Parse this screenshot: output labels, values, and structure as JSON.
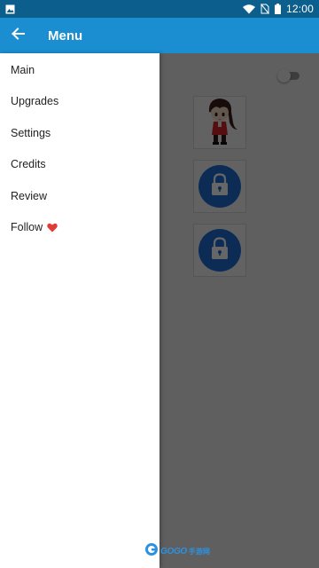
{
  "status_bar": {
    "time": "12:00",
    "color": "#0c5f8c",
    "icons": [
      "gallery-icon",
      "wifi-icon",
      "no-sim-icon",
      "battery-icon"
    ]
  },
  "app_bar": {
    "title": "Menu",
    "back_icon": "arrow-left-icon",
    "color": "#1a8ed0"
  },
  "drawer": {
    "items": [
      {
        "label": "Main"
      },
      {
        "label": "Upgrades"
      },
      {
        "label": "Settings"
      },
      {
        "label": "Credits"
      },
      {
        "label": "Review"
      },
      {
        "label": "Follow",
        "icon": "heart-icon",
        "icon_color": "#e53935"
      }
    ]
  },
  "content": {
    "toggle_on": false,
    "cards": [
      {
        "type": "character",
        "icon": "character-avatar"
      },
      {
        "type": "locked",
        "icon": "lock-icon"
      },
      {
        "type": "locked",
        "icon": "lock-icon"
      }
    ],
    "lock_color": "#1f6fd4"
  },
  "watermark": {
    "text": "GOGO",
    "suffix": "手游网"
  }
}
